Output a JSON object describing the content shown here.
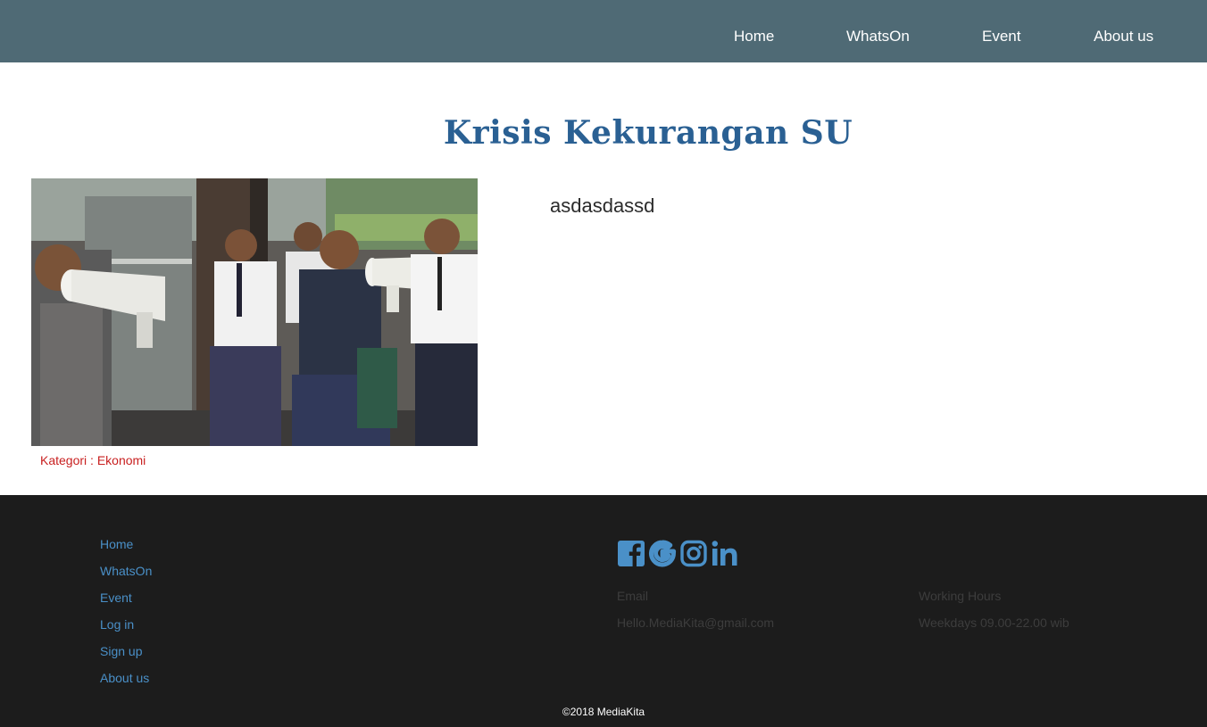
{
  "nav": {
    "items": [
      {
        "label": "Home"
      },
      {
        "label": "WhatsOn"
      },
      {
        "label": "Event"
      },
      {
        "label": "About us"
      }
    ]
  },
  "article": {
    "title": "Krisis Kekurangan SU",
    "body": "asdasdassd",
    "category": "Kategori : Ekonomi",
    "image_icon": "photo-image"
  },
  "footer": {
    "links": [
      {
        "label": "Home"
      },
      {
        "label": "WhatsOn"
      },
      {
        "label": "Event"
      },
      {
        "label": "Log in"
      },
      {
        "label": "Sign up"
      },
      {
        "label": "About us"
      }
    ],
    "socials": [
      "facebook-icon",
      "google-icon",
      "instagram-icon",
      "linkedin-icon"
    ],
    "email_label": "Email",
    "email_value": "Hello.MediaKita@gmail.com",
    "hours_label": "Working Hours",
    "hours_value": "Weekdays 09.00-22.00 wib",
    "copyright": "©2018 MediaKita"
  },
  "colors": {
    "nav_bg": "#4f6a75",
    "title": "#2a6093",
    "category": "#c81f1f",
    "footer_bg": "#1c1c1c",
    "footer_link": "#4a90c8",
    "social_icon": "#4a90c8"
  }
}
